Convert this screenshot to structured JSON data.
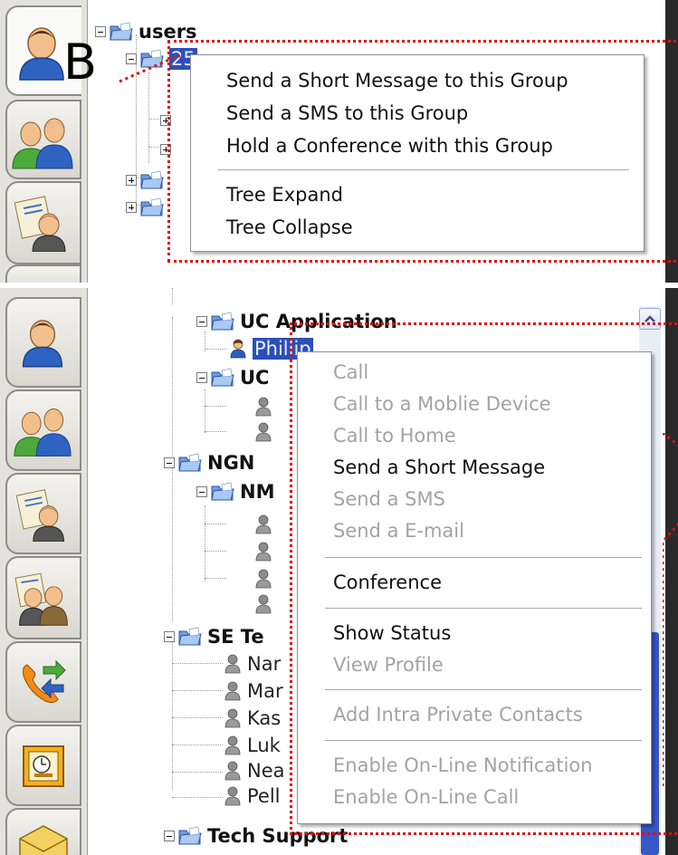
{
  "top_panel": {
    "marker": "B",
    "tree": {
      "root": "users",
      "selected_group": "25"
    },
    "context_menu": {
      "items": [
        {
          "label": "Send a Short Message to this Group",
          "enabled": true
        },
        {
          "label": "Send a SMS to this Group",
          "enabled": true
        },
        {
          "label": "Hold a Conference with this Group",
          "enabled": true
        },
        {
          "label": "Tree Expand",
          "enabled": true
        },
        {
          "label": "Tree Collapse",
          "enabled": true
        }
      ]
    }
  },
  "bottom_panel": {
    "tree": {
      "uc_application": "UC Application",
      "selected_user": "Phillip",
      "uc2": "UC",
      "ngn": "NGN",
      "nm": "NM",
      "se_team": "SE Te",
      "users": [
        "Nar",
        "Mar",
        "Kas",
        "Luk",
        "Nea",
        "Pell"
      ],
      "tech_support": "Tech Support"
    },
    "context_menu": {
      "items": [
        {
          "label": "Call",
          "enabled": false
        },
        {
          "label": "Call to a Moblie Device",
          "enabled": false
        },
        {
          "label": "Call to Home",
          "enabled": false
        },
        {
          "label": "Send a Short Message",
          "enabled": true
        },
        {
          "label": "Send a SMS",
          "enabled": false
        },
        {
          "label": "Send a E-mail",
          "enabled": false
        },
        {
          "label": "Conference",
          "enabled": true
        },
        {
          "label": "Show Status",
          "enabled": true
        },
        {
          "label": "View Profile",
          "enabled": false
        },
        {
          "label": "Add Intra Private Contacts",
          "enabled": false
        },
        {
          "label": "Enable On-Line Notification",
          "enabled": false
        },
        {
          "label": "Enable On-Line Call",
          "enabled": false
        }
      ]
    }
  },
  "icons": {
    "tabs": [
      "person-icon",
      "group-icon",
      "contact-card-icon",
      "group-contacts-icon",
      "phone-transfer-icon",
      "calendar-icon",
      "mail-icon"
    ]
  },
  "colors": {
    "highlight_red": "#e01010",
    "selection_blue": "#2c4fb8",
    "disabled_gray": "#a3a3a3"
  }
}
